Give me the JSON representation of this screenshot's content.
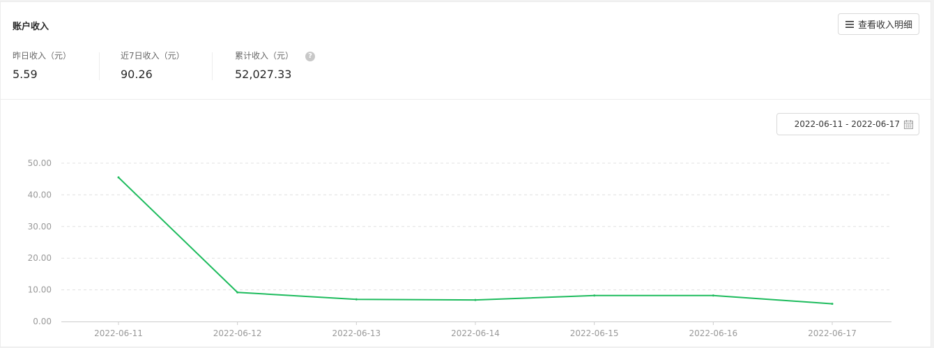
{
  "card": {
    "title": "账户收入",
    "detail_button_label": "查看收入明细"
  },
  "stats": [
    {
      "label": "昨日收入（元）",
      "value": "5.59"
    },
    {
      "label": "近7日收入（元）",
      "value": "90.26"
    },
    {
      "label": "累计收入（元）",
      "value": "52,027.33"
    }
  ],
  "date_range": {
    "value": "2022-06-11 - 2022-06-17"
  },
  "colors": {
    "line": "#1cbb5c",
    "grid": "#e0e0e0",
    "axis": "#cccccc"
  },
  "chart_data": {
    "type": "line",
    "x": [
      "2022-06-11",
      "2022-06-12",
      "2022-06-13",
      "2022-06-14",
      "2022-06-15",
      "2022-06-16",
      "2022-06-17"
    ],
    "series": [
      {
        "values": [
          45.5,
          9.2,
          7.0,
          6.8,
          8.2,
          8.2,
          5.6
        ]
      }
    ],
    "y_ticks": [
      "0.00",
      "10.00",
      "20.00",
      "30.00",
      "40.00",
      "50.00"
    ],
    "ylim": [
      0,
      50
    ],
    "grid": true
  }
}
